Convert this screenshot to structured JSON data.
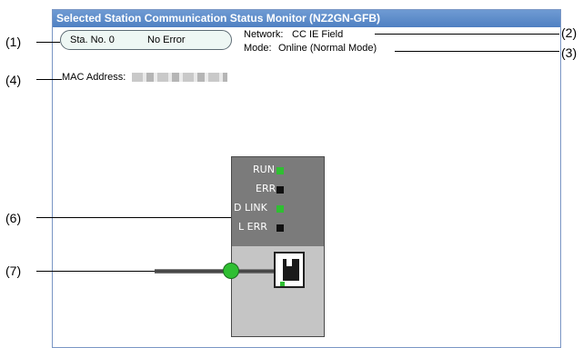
{
  "window": {
    "title": "Selected Station Communication Status Monitor (NZ2GN-GFB)"
  },
  "status": {
    "station": "Sta. No. 0",
    "error": "No Error"
  },
  "network": {
    "label": "Network:",
    "value": "CC IE Field"
  },
  "mode": {
    "label": "Mode:",
    "value": "Online (Normal Mode)"
  },
  "mac": {
    "label": "MAC Address:"
  },
  "callouts": [
    "(1)",
    "(2)",
    "(3)",
    "(4)",
    "(6)",
    "(7)"
  ],
  "leds": [
    {
      "label": "RUN",
      "state": "on",
      "color": "#2fbf32"
    },
    {
      "label": "ERR",
      "state": "off",
      "color": "#111111"
    },
    {
      "label": "D LINK",
      "state": "on",
      "color": "#2fbf32"
    },
    {
      "label": "L ERR",
      "state": "off",
      "color": "#111111"
    }
  ],
  "icons": [
    "ethernet-port-icon",
    "connection-node-icon"
  ]
}
